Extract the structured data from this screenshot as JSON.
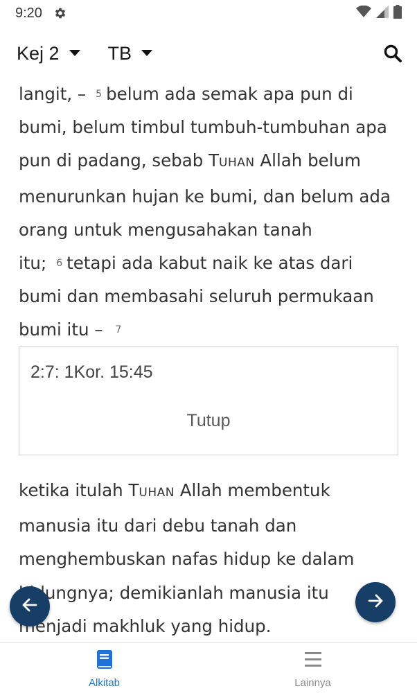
{
  "status_bar": {
    "time": "9:20",
    "icons": [
      "gear-icon",
      "wifi-icon",
      "signal-icon",
      "battery-icon"
    ]
  },
  "toolbar": {
    "book_chapter": "Kej 2",
    "version": "TB",
    "icons": [
      "chevron-down-icon",
      "search-icon"
    ]
  },
  "passage": {
    "line_1_start": "langit, –",
    "verse_5_num": "5",
    "verse_5_a": "belum ada semak apa pun di bumi, belum timbul tumbuh-tumbuhan apa pun di padang, sebab ",
    "lord_T": "T",
    "lord_rest": "uhan",
    "verse_5_b": " Allah belum menurunkan hujan ke bumi, dan belum ada orang untuk mengusahakan tanah itu;",
    "verse_6_num": "6",
    "verse_6": "tetapi ada kabut naik ke atas dari bumi dan membasahi seluruh permukaan bumi itu –",
    "verse_7_num": "7",
    "verse_7_a": "ketika itulah ",
    "lord2_T": "T",
    "lord2_rest": "uhan",
    "verse_7_b": " Allah membentuk manusia itu dari debu tanah dan menghembuskan nafas hidup ke dalam hidungnya; demikianlah manusia itu menjadi makhluk yang hidup."
  },
  "cross_reference": {
    "text": "2:7: 1Kor. 15:45",
    "close_label": "Tutup"
  },
  "bottom_nav": {
    "items": [
      {
        "label": "Alkitab",
        "icon": "book-icon",
        "active": true
      },
      {
        "label": "Lainnya",
        "icon": "menu-icon",
        "active": false
      }
    ]
  },
  "colors": {
    "accent": "#1e73d8",
    "fab": "#163e66",
    "text": "#333333"
  }
}
